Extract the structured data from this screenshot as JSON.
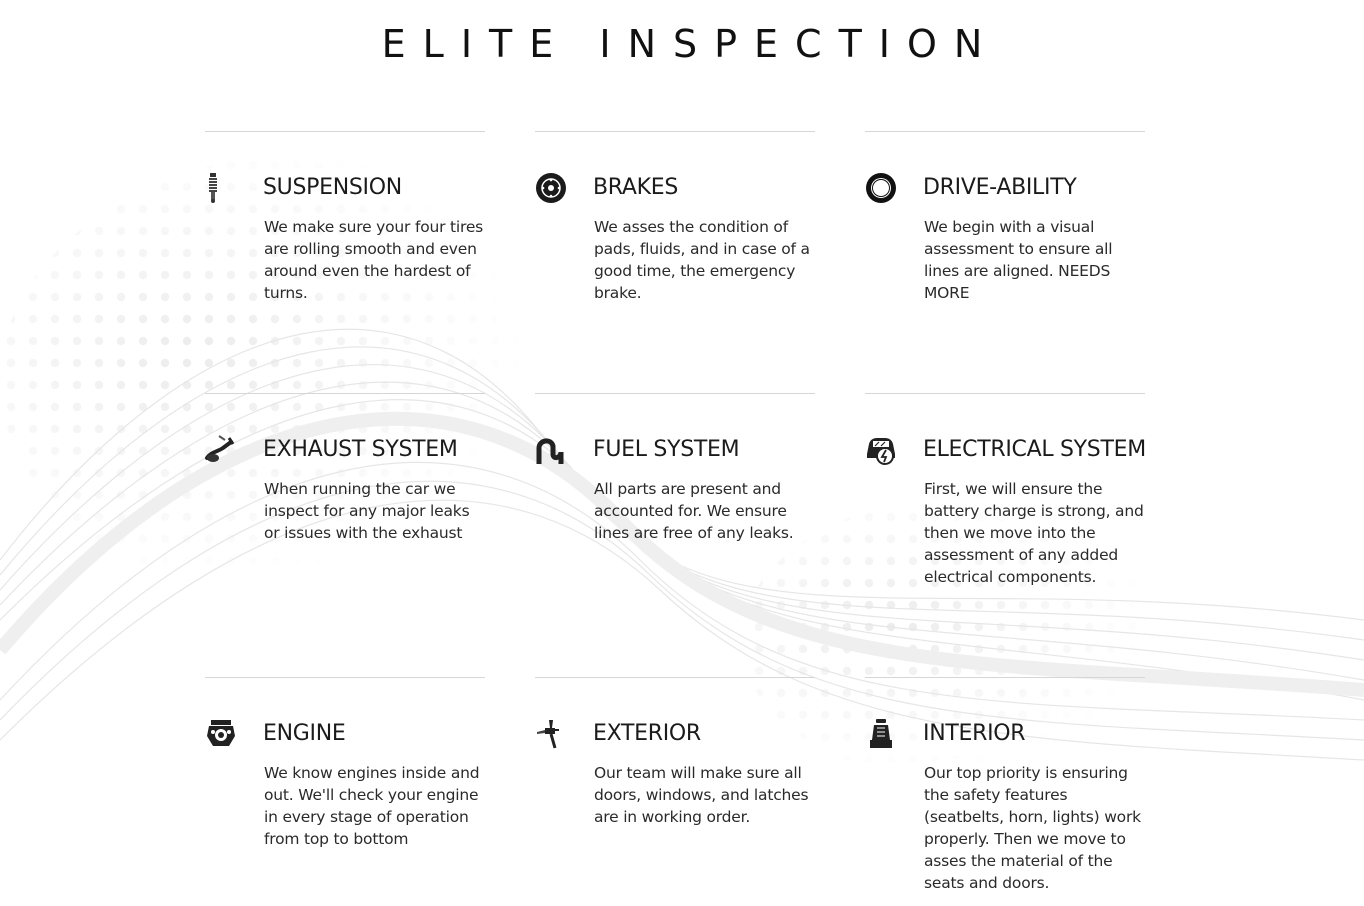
{
  "page": {
    "title": "ELITE INSPECTION"
  },
  "cards": [
    {
      "title": "SUSPENSION",
      "icon": "shock-absorber-icon",
      "text": "We make sure your four tires are rolling smooth and even around even the hardest of turns."
    },
    {
      "title": "BRAKES",
      "icon": "brake-disc-icon",
      "text": "We asses the condition of pads, fluids, and in case of a good time, the emergency brake."
    },
    {
      "title": "DRIVE-ABILITY",
      "icon": "tire-icon",
      "text": "We begin with a visual assessment to ensure all lines are aligned. NEEDS MORE"
    },
    {
      "title": "EXHAUST SYSTEM",
      "icon": "exhaust-pipe-icon",
      "text": "When running the car we inspect for any major leaks or issues with the exhaust"
    },
    {
      "title": "FUEL SYSTEM",
      "icon": "fuel-line-icon",
      "text": "All parts are present and accounted for. We ensure lines are free of any leaks."
    },
    {
      "title": "ELECTRICAL SYSTEM",
      "icon": "car-battery-icon",
      "text": "First, we will ensure the battery charge is strong, and then we move into the assessment of any added electrical components."
    },
    {
      "title": "ENGINE",
      "icon": "engine-icon",
      "text": "We know engines inside and out. We'll check your engine in every stage of operation from top to bottom"
    },
    {
      "title": "EXTERIOR",
      "icon": "spray-gun-icon",
      "text": "Our team will make sure all doors, windows, and latches are in working order."
    },
    {
      "title": "INTERIOR",
      "icon": "car-seat-icon",
      "text": "Our top priority is ensuring the safety features (seatbelts, horn, lights) work properly. Then we move to asses the material of the seats and doors."
    }
  ]
}
